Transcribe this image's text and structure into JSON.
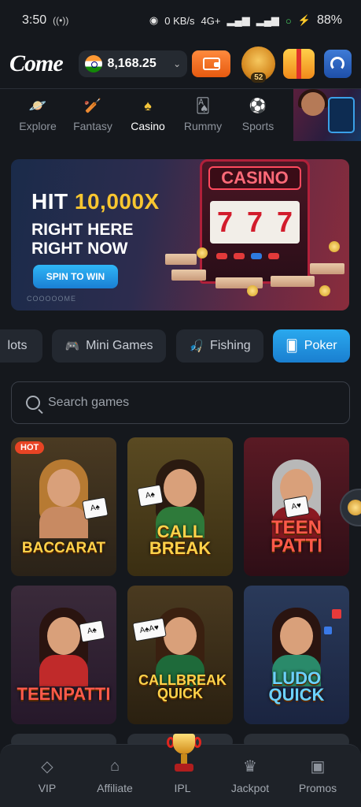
{
  "status_bar": {
    "time": "3:50",
    "network_speed": "0 KB/s",
    "network_type": "4G+",
    "battery": "88%"
  },
  "header": {
    "logo": "Come",
    "country_flag": "india-flag-icon",
    "balance": "8,168.25",
    "vip_level": "52"
  },
  "categories": [
    {
      "label": "Explore",
      "icon": "planet-icon"
    },
    {
      "label": "Fantasy",
      "icon": "bat-icon"
    },
    {
      "label": "Casino",
      "icon": "spade-icon",
      "active": true
    },
    {
      "label": "Rummy",
      "icon": "card-icon"
    },
    {
      "label": "Sports",
      "icon": "football-icon"
    }
  ],
  "banner": {
    "headline_prefix": "HIT",
    "headline_highlight": "10,000X",
    "line2": "RIGHT HERE",
    "line3": "RIGHT NOW",
    "cta": "SPIN TO WIN",
    "sign": "CASINO",
    "reels": [
      "7",
      "7",
      "7"
    ],
    "brand": "COOOOOME"
  },
  "filter_tabs": [
    {
      "label": "lots",
      "icon": "slot-icon"
    },
    {
      "label": "Mini Games",
      "icon": "gamepad-icon"
    },
    {
      "label": "Fishing",
      "icon": "fish-icon"
    },
    {
      "label": "Poker",
      "icon": "poker-cards-icon",
      "active": true
    }
  ],
  "search": {
    "placeholder": "Search games",
    "value": ""
  },
  "games": [
    {
      "title": "BACCARAT",
      "badge": "HOT"
    },
    {
      "title": "CALL BREAK",
      "badge": ""
    },
    {
      "title": "TEEN PATTI",
      "badge": ""
    },
    {
      "title": "TEENPATTI",
      "badge": ""
    },
    {
      "title": "CALLBREAK QUICK",
      "badge": ""
    },
    {
      "title": "LUDO QUICK",
      "badge": ""
    }
  ],
  "bottom_nav": [
    {
      "label": "VIP",
      "icon": "diamond-icon"
    },
    {
      "label": "Affiliate",
      "icon": "affiliate-icon"
    },
    {
      "label": "IPL",
      "icon": "trophy-icon"
    },
    {
      "label": "Jackpot",
      "icon": "jackpot-icon"
    },
    {
      "label": "Promos",
      "icon": "gift-icon"
    }
  ],
  "colors": {
    "background": "#15181d",
    "accent_blue": "#1a8fe0",
    "accent_orange": "#f26a1b",
    "highlight_yellow": "#f8c630",
    "hot_badge": "#e84424"
  }
}
